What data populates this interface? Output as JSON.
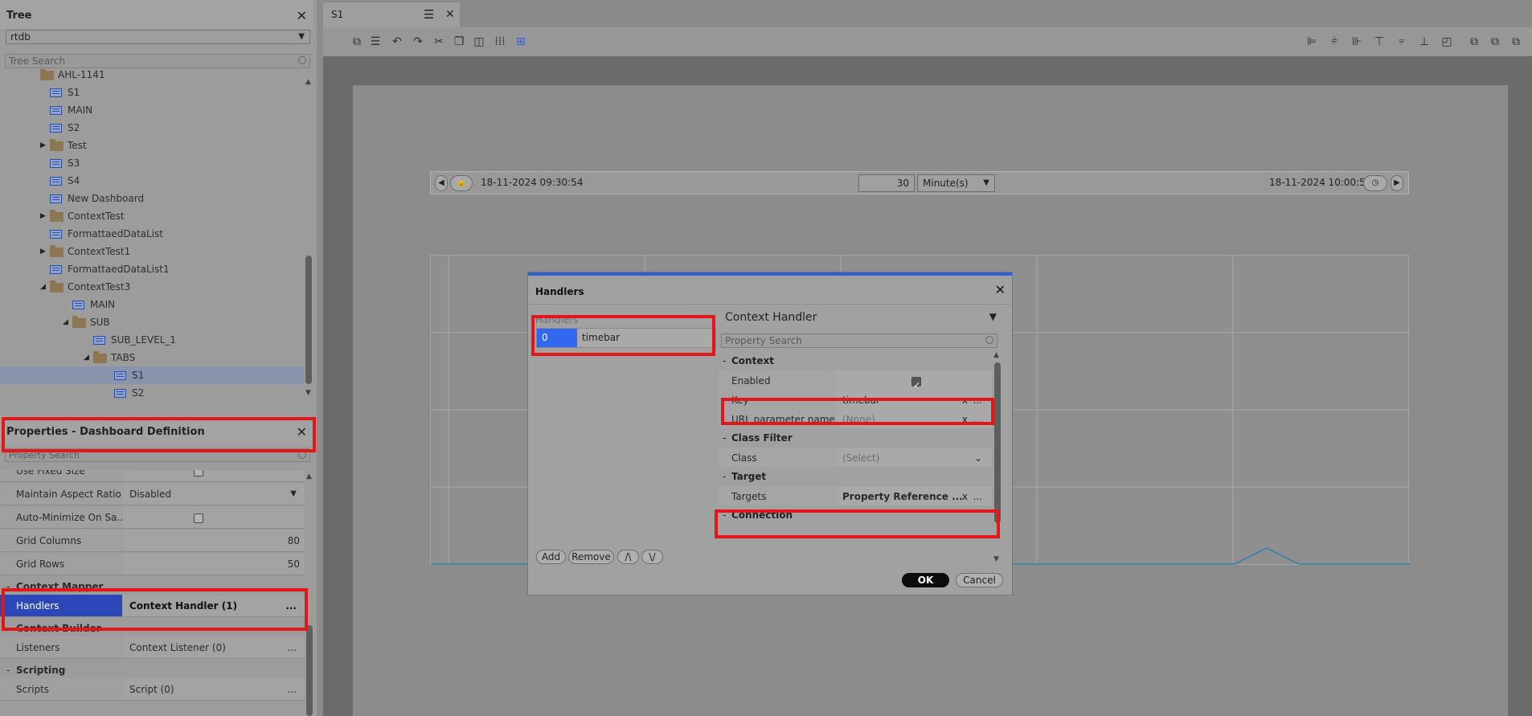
{
  "tree_panel": {
    "title": "Tree",
    "source": "rtdb",
    "search_placeholder": "Tree Search",
    "items": [
      {
        "label": "AHL-1141",
        "type": "folder",
        "level": 1
      },
      {
        "label": "S1",
        "type": "dashboard",
        "level": 2
      },
      {
        "label": "MAIN",
        "type": "dashboard",
        "level": 2
      },
      {
        "label": "S2",
        "type": "dashboard",
        "level": 2
      },
      {
        "label": "Test",
        "type": "folder",
        "level": 2,
        "expander": "collapsed"
      },
      {
        "label": "S3",
        "type": "dashboard",
        "level": 2
      },
      {
        "label": "S4",
        "type": "dashboard",
        "level": 2
      },
      {
        "label": "New Dashboard",
        "type": "dashboard",
        "level": 2
      },
      {
        "label": "ContextTest",
        "type": "folder",
        "level": 2,
        "expander": "collapsed"
      },
      {
        "label": "FormattaedDataList",
        "type": "dashboard",
        "level": 2
      },
      {
        "label": "ContextTest1",
        "type": "folder",
        "level": 2,
        "expander": "collapsed"
      },
      {
        "label": "FormattaedDataList1",
        "type": "dashboard",
        "level": 2
      },
      {
        "label": "ContextTest3",
        "type": "folder",
        "level": 2,
        "expander": "expanded"
      },
      {
        "label": "MAIN",
        "type": "dashboard",
        "level": 3
      },
      {
        "label": "SUB",
        "type": "folder",
        "level": 3,
        "expander": "expanded"
      },
      {
        "label": "SUB_LEVEL_1",
        "type": "dashboard",
        "level": 4
      },
      {
        "label": "TABS",
        "type": "folder",
        "level": 4,
        "expander": "expanded"
      },
      {
        "label": "S1",
        "type": "dashboard",
        "level": 5,
        "selected": true
      },
      {
        "label": "S2",
        "type": "dashboard",
        "level": 5
      }
    ]
  },
  "properties_panel": {
    "title": "Properties - Dashboard Definition",
    "search_placeholder": "Property Search",
    "rows": [
      {
        "kind": "prop",
        "name": "Use Fixed Size",
        "value": "",
        "control": "checkbox",
        "checked": false
      },
      {
        "kind": "prop",
        "name": "Maintain Aspect Ratio",
        "value": "Disabled",
        "control": "dropdown"
      },
      {
        "kind": "prop",
        "name": "Auto-Minimize On Sa...",
        "value": "",
        "control": "checkbox",
        "checked": false
      },
      {
        "kind": "prop",
        "name": "Grid Columns",
        "value": "80",
        "control": "number"
      },
      {
        "kind": "prop",
        "name": "Grid Rows",
        "value": "50",
        "control": "number"
      },
      {
        "kind": "cat",
        "name": "Context Mapper"
      },
      {
        "kind": "prop",
        "name": "Handlers",
        "value": "Context Handler (1)",
        "control": "ellipsis",
        "highlight": true
      },
      {
        "kind": "cat",
        "name": "Context Builder"
      },
      {
        "kind": "prop",
        "name": "Listeners",
        "value": "Context Listener (0)",
        "control": "ellipsis"
      },
      {
        "kind": "cat",
        "name": "Scripting"
      },
      {
        "kind": "prop",
        "name": "Scripts",
        "value": "Script (0)",
        "control": "ellipsis"
      }
    ]
  },
  "editor": {
    "tab_label": "S1",
    "timebar": {
      "start": "18-11-2024 09:30:54",
      "duration": "30",
      "unit": "Minute(s)",
      "end": "18-11-2024 10:00:54"
    }
  },
  "dialog": {
    "title": "Handlers",
    "list_label": "Handlers",
    "handlers": [
      {
        "index": "0",
        "name": "timebar"
      }
    ],
    "buttons": {
      "add": "Add",
      "remove": "Remove",
      "up": "/\\",
      "down": "\\/",
      "ok": "OK",
      "cancel": "Cancel"
    },
    "editor_type": "Context Handler",
    "search_placeholder": "Property Search",
    "grid": [
      {
        "kind": "cat",
        "name": "Context"
      },
      {
        "kind": "prop",
        "name": "Enabled",
        "control": "checkbox",
        "checked": true
      },
      {
        "kind": "prop",
        "name": "Key",
        "value": "timebar",
        "control": "text-clear"
      },
      {
        "kind": "prop",
        "name": "URL parameter name",
        "value": "(None)",
        "control": "text-clear",
        "muted": true
      },
      {
        "kind": "cat",
        "name": "Class Filter"
      },
      {
        "kind": "prop",
        "name": "Class",
        "value": "(Select)",
        "control": "dropdown",
        "muted": true
      },
      {
        "kind": "cat",
        "name": "Target"
      },
      {
        "kind": "prop",
        "name": "Targets",
        "value": "Property Reference ...",
        "control": "text-clear",
        "bold": true
      },
      {
        "kind": "cat",
        "name": "Connection"
      }
    ]
  },
  "colors": {
    "highlight_red": "#e3161c",
    "selection_blue": "#2b47b8",
    "dialog_accent": "#2f5fd6"
  }
}
